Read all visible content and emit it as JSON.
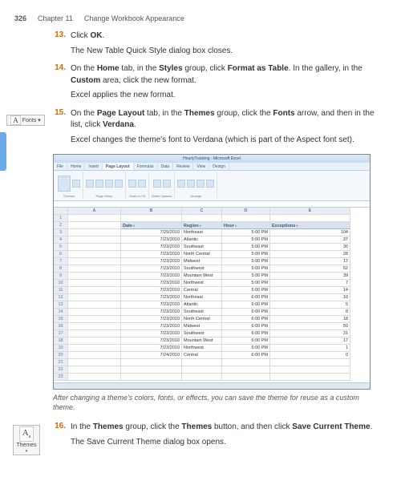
{
  "header": {
    "page": "326",
    "chapter": "Chapter 11",
    "title": "Change Workbook Appearance"
  },
  "steps": {
    "s13": {
      "num": "13.",
      "l1a": "Click ",
      "l1b": "OK",
      "l1c": ".",
      "l2": "The New Table Quick Style dialog box closes."
    },
    "s14": {
      "num": "14.",
      "a": "On the ",
      "b": "Home",
      "c": " tab, in the ",
      "d": "Styles",
      "e": " group, click ",
      "f": "Format as Table",
      "g": ". In the gallery, in the ",
      "h": "Custom",
      "i": " area, click the new format.",
      "l2": "Excel applies the new format."
    },
    "s15": {
      "num": "15.",
      "a": "On the ",
      "b": "Page Layout",
      "c": " tab, in the ",
      "d": "Themes",
      "e": " group, click the ",
      "f": "Fonts",
      "g": " arrow, and then in the list, click ",
      "h": "Verdana",
      "i": ".",
      "l2": "Excel changes the theme's font to Verdana (which is part of the Aspect font set)."
    },
    "s16": {
      "num": "16.",
      "a": "In the ",
      "b": "Themes",
      "c": " group, click the ",
      "d": "Themes",
      "e": " button, and then click ",
      "f": "Save Current Theme",
      "g": ".",
      "l2": "The Save Current Theme dialog box opens."
    }
  },
  "callouts": {
    "fonts": "Fonts ▾",
    "themes": "Themes"
  },
  "caption": "After changing a theme's colors, fonts, or effects, you can save the theme for reuse as a custom theme.",
  "excel": {
    "title": "HourlyTracking - Microsoft Excel",
    "tabs": [
      "File",
      "Home",
      "Insert",
      "Page Layout",
      "Formulas",
      "Data",
      "Review",
      "View",
      "Design"
    ],
    "activetab": 3,
    "groups": [
      "Themes",
      "Page Setup",
      "Scale to Fit",
      "Sheet Options",
      "Arrange"
    ],
    "cols": [
      "",
      "A",
      "B",
      "C",
      "D",
      "E"
    ],
    "headers": [
      "Date",
      "Region",
      "Hour",
      "Exceptions"
    ],
    "rows": [
      [
        "7/29/2010",
        "Northeast",
        "5:00 PM",
        "104"
      ],
      [
        "7/23/2010",
        "Atlantic",
        "5:00 PM",
        "37"
      ],
      [
        "7/23/2010",
        "Southeast",
        "5:00 PM",
        "30"
      ],
      [
        "7/23/2010",
        "North Central",
        "5:00 PM",
        "28"
      ],
      [
        "7/23/2010",
        "Midwest",
        "5:00 PM",
        "17"
      ],
      [
        "7/23/2010",
        "Southwest",
        "5:00 PM",
        "52"
      ],
      [
        "7/23/2010",
        "Mountain West",
        "5:00 PM",
        "39"
      ],
      [
        "7/23/2010",
        "Northwest",
        "5:00 PM",
        "7"
      ],
      [
        "7/23/2010",
        "Central",
        "5:00 PM",
        "14"
      ],
      [
        "7/23/2010",
        "Northeast",
        "6:00 PM",
        "10"
      ],
      [
        "7/23/2010",
        "Atlantic",
        "6:00 PM",
        "5"
      ],
      [
        "7/23/2010",
        "Southeast",
        "6:00 PM",
        "8"
      ],
      [
        "7/23/2010",
        "North Central",
        "6:00 PM",
        "18"
      ],
      [
        "7/23/2010",
        "Midwest",
        "6:00 PM",
        "50"
      ],
      [
        "7/23/2010",
        "Southwest",
        "6:00 PM",
        "31"
      ],
      [
        "7/23/2010",
        "Mountain West",
        "6:00 PM",
        "17"
      ],
      [
        "7/23/2010",
        "Northwest",
        "6:00 PM",
        "1"
      ],
      [
        "7/24/2010",
        "Central",
        "6:00 PM",
        "0"
      ]
    ]
  }
}
